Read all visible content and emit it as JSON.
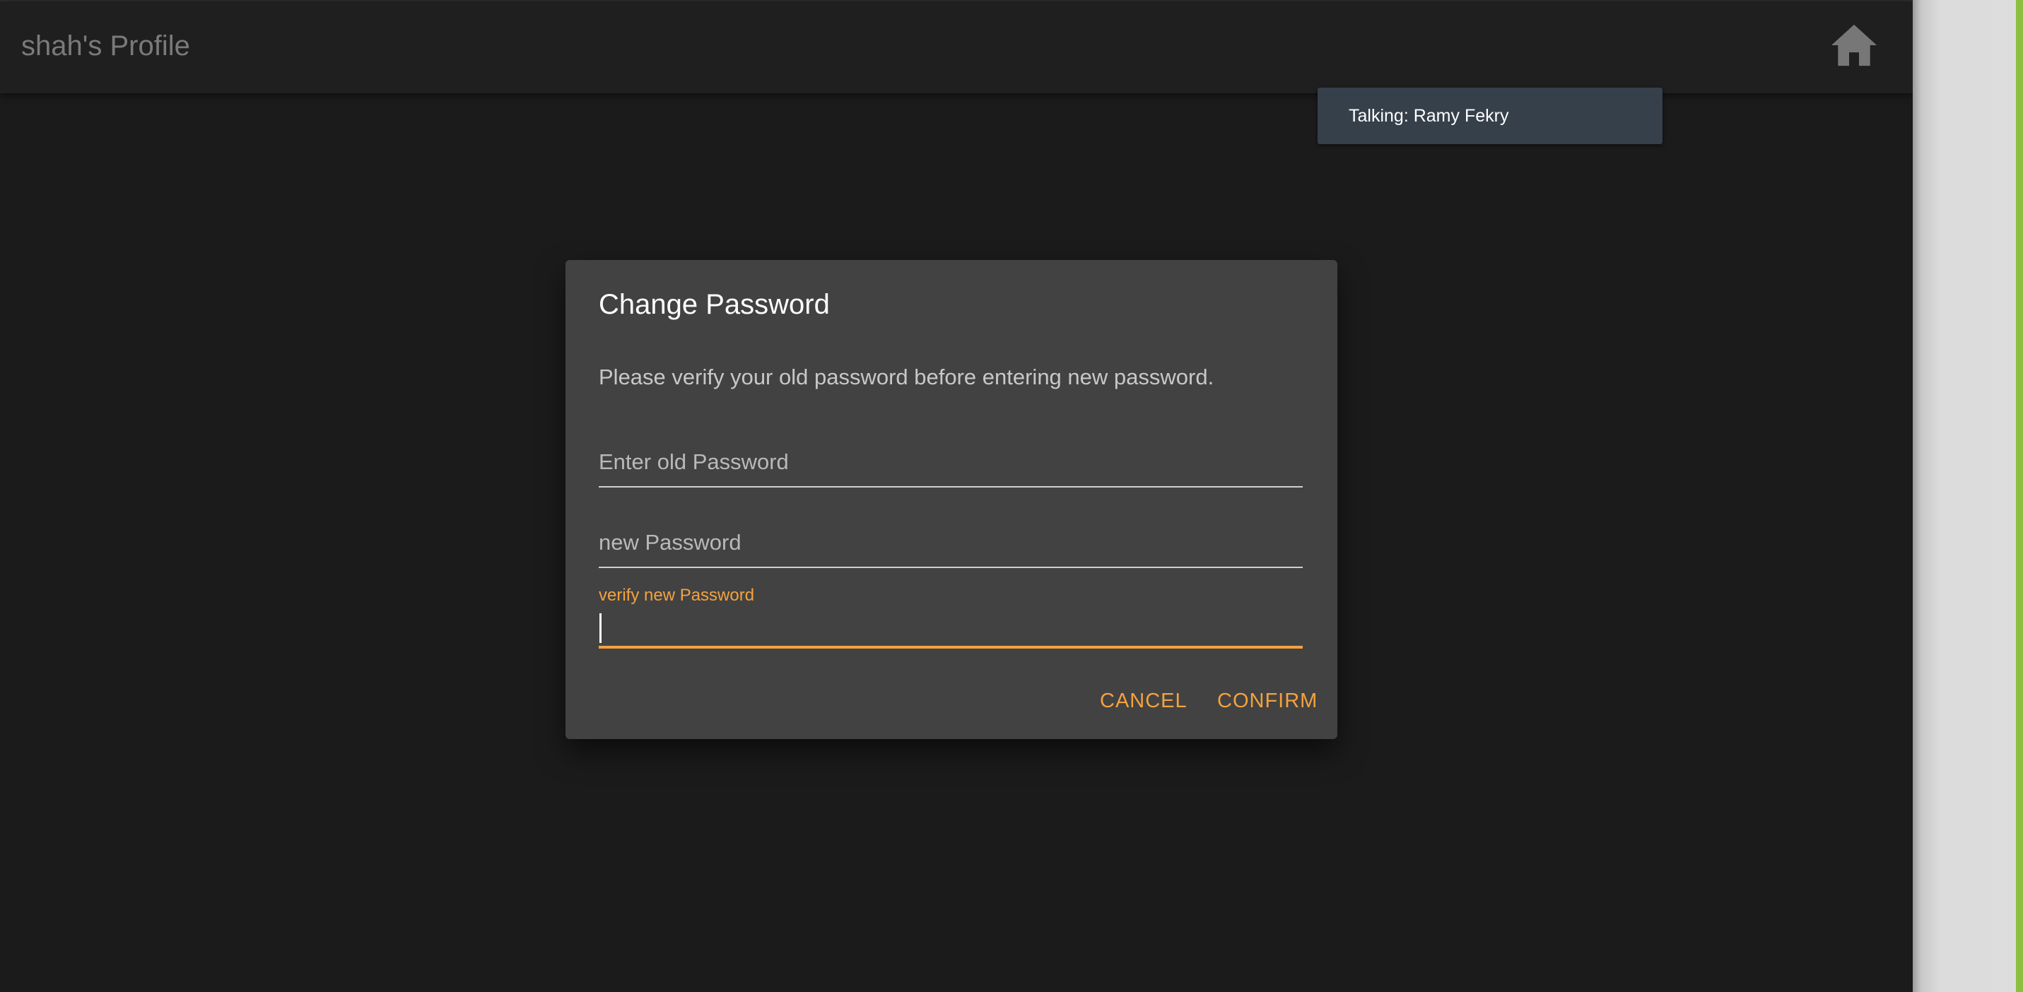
{
  "header": {
    "title": "shah's Profile",
    "home_icon": "home-icon"
  },
  "toast": {
    "text": "Talking: Ramy Fekry"
  },
  "dialog": {
    "title": "Change Password",
    "message": "Please verify your old password before entering new password.",
    "fields": [
      {
        "label": "Enter old Password",
        "value": "",
        "focused": false
      },
      {
        "label": "new Password",
        "value": "",
        "focused": false
      },
      {
        "label": "verify new Password",
        "value": "",
        "focused": true
      }
    ],
    "actions": {
      "cancel_label": "CANCEL",
      "confirm_label": "CONFIRM"
    }
  },
  "colors": {
    "background": "#1b1b1b",
    "dialog": "#424242",
    "accent": "#f4a23f",
    "toast": "#35404b",
    "side_accent": "#8cbf3f"
  }
}
